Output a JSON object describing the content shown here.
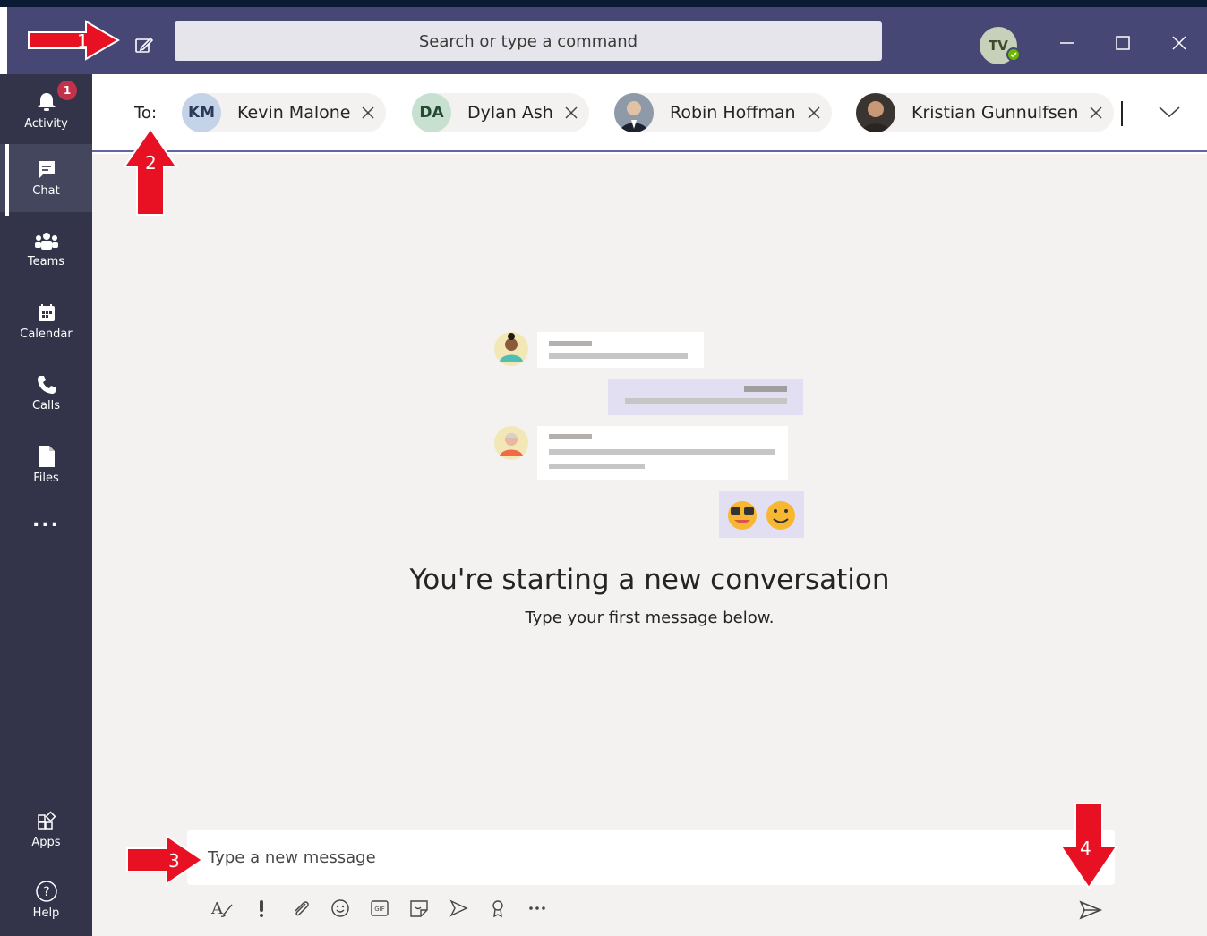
{
  "titlebar": {
    "search_placeholder": "Search or type a command",
    "avatar_initials": "TV"
  },
  "rail": {
    "items": [
      {
        "label": "Activity",
        "badge": "1"
      },
      {
        "label": "Chat"
      },
      {
        "label": "Teams"
      },
      {
        "label": "Calendar"
      },
      {
        "label": "Calls"
      },
      {
        "label": "Files"
      },
      {
        "label": "..."
      },
      {
        "label": "Apps"
      },
      {
        "label": "Help"
      }
    ]
  },
  "to_bar": {
    "label": "To:",
    "recipients": [
      {
        "initials": "KM",
        "name": "Kevin Malone"
      },
      {
        "initials": "DA",
        "name": "Dylan Ash"
      },
      {
        "initials": "",
        "name": "Robin Hoffman"
      },
      {
        "initials": "",
        "name": "Kristian Gunnulfsen"
      }
    ]
  },
  "conversation": {
    "headline": "You're starting a new conversation",
    "subline": "Type your first message below."
  },
  "composer": {
    "placeholder": "Type a new message"
  },
  "annotations": [
    "1",
    "2",
    "3",
    "4"
  ],
  "colors": {
    "titlebar": "#464775",
    "rail": "#33344a",
    "accent": "#6264a7",
    "annotation_arrow": "#e81123"
  }
}
